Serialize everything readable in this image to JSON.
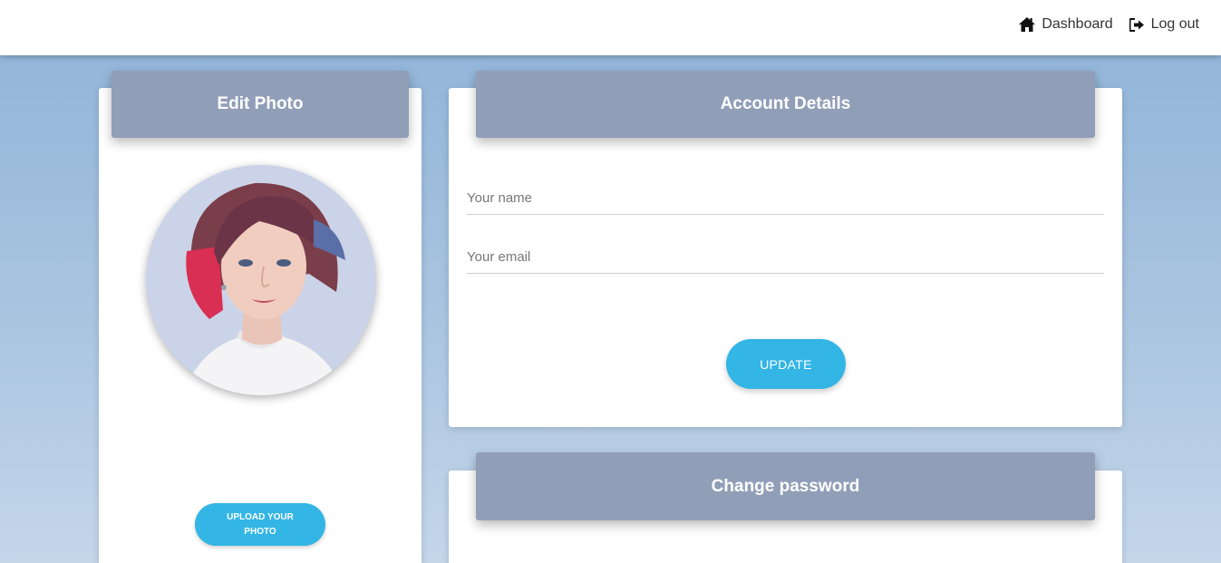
{
  "nav": {
    "dashboard_label": "Dashboard",
    "logout_label": "Log out"
  },
  "photo_card": {
    "title": "Edit Photo",
    "upload_label": "UPLOAD YOUR PHOTO"
  },
  "account_card": {
    "title": "Account Details",
    "name_placeholder": "Your name",
    "email_placeholder": "Your email",
    "update_label": "UPDATE"
  },
  "password_card": {
    "title": "Change password"
  },
  "icons": {
    "dashboard": "home-icon",
    "logout": "sign-out-icon"
  },
  "colors": {
    "header_bg": "#919eb8",
    "button_bg": "#33b5e5",
    "page_bg": "#a9c4e0"
  }
}
